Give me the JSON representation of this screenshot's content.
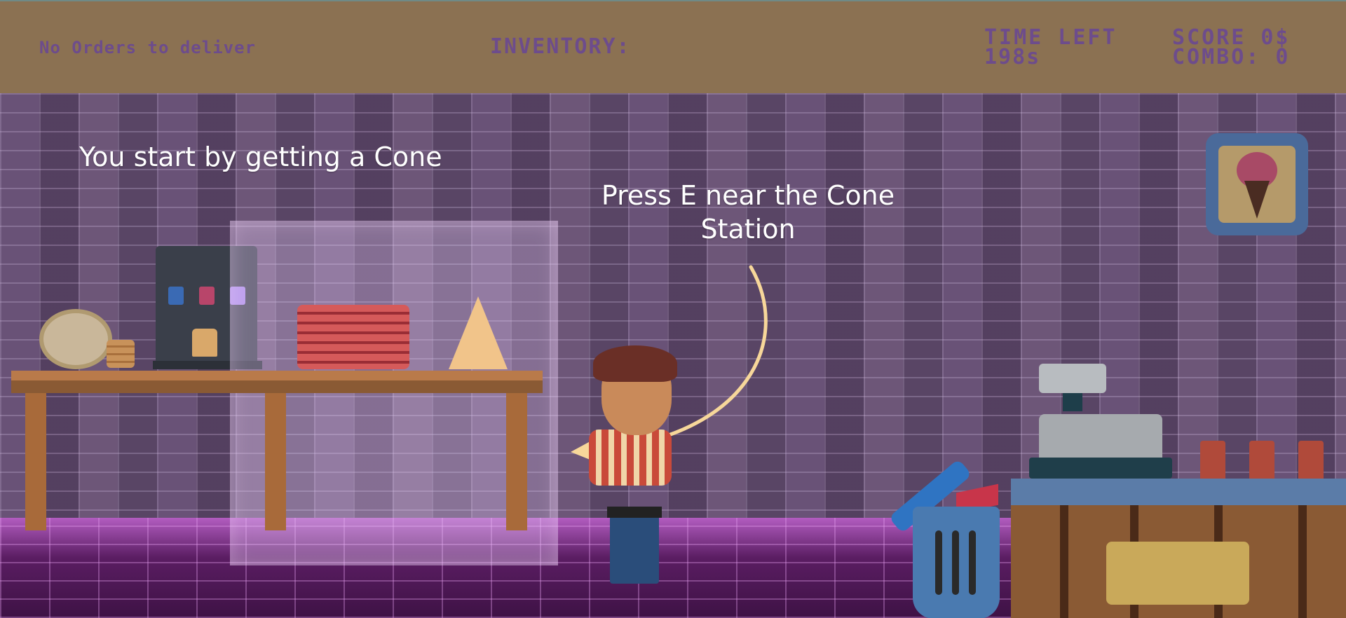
{
  "hud": {
    "orders_status": "No Orders to deliver",
    "inventory_label": "INVENTORY:",
    "time_label": "TIME LEFT",
    "time_value": "198s",
    "score": "SCORE 0$",
    "combo": "COMBO: 0"
  },
  "tutorial": {
    "line1": "You start by getting a Cone",
    "line2": "Press E near the Cone Station"
  },
  "colors": {
    "hud_bg": "#8b7152",
    "hud_text": "#6d4c8c",
    "arrow": "#f7d79a",
    "wall": "#5c4766",
    "floor": "#6a2a72"
  },
  "icons": {
    "tutorial_arrow": "curved-arrow-icon",
    "trash": "trash-can-icon",
    "frame": "ice-cream-picture-icon"
  }
}
